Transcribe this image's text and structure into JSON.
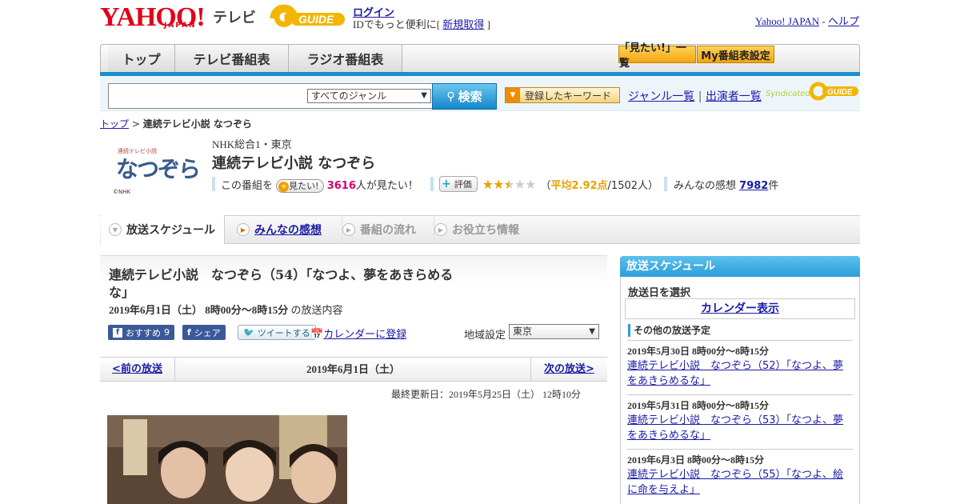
{
  "header": {
    "logo_yahoo": "YAHOO!",
    "logo_japan": "JAPAN",
    "logo_tv": "テレビ",
    "logo_gguide": "GUIDE",
    "login": "ログイン",
    "login_sub_prefix": "IDでもっと便利に[",
    "register": "新規取得",
    "login_sub_suffix": "]",
    "yahoo_japan": "Yahoo! JAPAN",
    "sep": "-",
    "help": "ヘルプ"
  },
  "nav": {
    "tabs": [
      "トップ",
      "テレビ番組表",
      "ラジオ番組表"
    ],
    "want_list": "「見たい!」一覧",
    "my_settings": "My番組表設定"
  },
  "search": {
    "genre": "すべてのジャンル",
    "button": "検索",
    "keywords": "登録したキーワード",
    "genre_list": "ジャンル一覧",
    "divider": "|",
    "performers": "出演者一覧",
    "syndicated": "Syndicated"
  },
  "breadcrumb": {
    "top": "トップ",
    "sep": ">",
    "current": "連続テレビ小説 なつぞら"
  },
  "program": {
    "channel": "NHK総合1・東京",
    "title": "連続テレビ小説 なつぞら",
    "want_prefix": "この番組を",
    "want_button": "見たい!",
    "want_count": "3616",
    "want_suffix": "人が見たい！",
    "rate_button": "評価",
    "rating_value": 2.92,
    "rating_prefix": "（",
    "rating_label": "平均2.92点",
    "rating_suffix": "/1502人）",
    "review_label": "みんなの感想",
    "review_count": "7982",
    "review_unit": "件",
    "thumb_text": "なつぞら",
    "thumb_small": "連続テレビ小説",
    "thumb_credit": "©NHK"
  },
  "tabs": [
    "放送スケジュール",
    "みんなの感想",
    "番組の流れ",
    "お役立ち情報"
  ],
  "episode": {
    "title": "連続テレビ小説　なつぞら（54）「なつよ、夢をあきらめるな」",
    "date": "2019年6月1日（土）  8時00分～8時15分",
    "date_suffix": "の放送内容",
    "recommend": "おすすめ",
    "recommend_count": "9",
    "share": "シェア",
    "tweet": "ツイートする",
    "calendar": "カレンダーに登録",
    "region_label": "地域設定",
    "region_value": "東京"
  },
  "pager": {
    "prev": "<前の放送",
    "current": "2019年6月1日（土）",
    "next": "次の放送>"
  },
  "updated": "最終更新日：2019年5月25日（土）  12時10分",
  "sidebar": {
    "head": "放送スケジュール",
    "choose": "放送日を選択",
    "calendar": "カレンダー表示",
    "other": "その他の放送予定",
    "items": [
      {
        "date": "2019年5月30日  8時00分～8時15分",
        "title": "連続テレビ小説　なつぞら（52）「なつよ、夢をあきらめるな」"
      },
      {
        "date": "2019年5月31日  8時00分～8時15分",
        "title": "連続テレビ小説　なつぞら（53）「なつよ、夢をあきらめるな」"
      },
      {
        "date": "2019年6月3日  8時00分～8時15分",
        "title": "連続テレビ小説　なつぞら（55）「なつよ、絵に命を与えよ」"
      }
    ]
  },
  "colors": {
    "accent_blue": "#1a8fd0",
    "yahoo_red": "#e0001a",
    "gold": "#e8a200",
    "pink": "#d6006f"
  }
}
